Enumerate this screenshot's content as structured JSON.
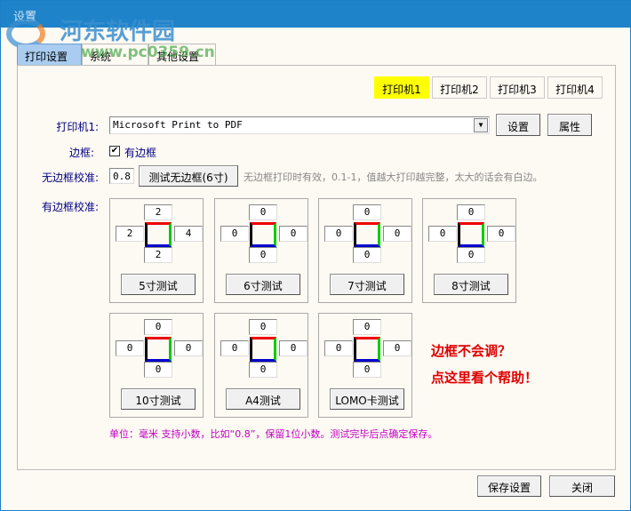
{
  "window": {
    "title": "设置",
    "watermark": "河东软件园",
    "watermark_url": "www.pc0359.cn"
  },
  "tabs": [
    "打印设置",
    "系统",
    "其他设置"
  ],
  "printer_tabs": [
    "打印机1",
    "打印机2",
    "打印机3",
    "打印机4"
  ],
  "printer": {
    "label": "打印机1:",
    "value": "Microsoft Print to PDF",
    "setup": "设置",
    "props": "属性"
  },
  "border": {
    "label": "边框:",
    "checkbox": "有边框",
    "checked": true
  },
  "borderless": {
    "label": "无边框校准:",
    "value": "0.8",
    "test": "测试无边框(6寸)",
    "hint": "无边框打印时有效，0.1-1，值越大打印越完整，太大的话会有白边。"
  },
  "bordered": {
    "label": "有边框校准:"
  },
  "calibrations": [
    {
      "top": "2",
      "left": "2",
      "right": "4",
      "bottom": "2",
      "button": "5寸测试"
    },
    {
      "top": "0",
      "left": "0",
      "right": "0",
      "bottom": "0",
      "button": "6寸测试"
    },
    {
      "top": "0",
      "left": "0",
      "right": "0",
      "bottom": "0",
      "button": "7寸测试"
    },
    {
      "top": "0",
      "left": "0",
      "right": "0",
      "bottom": "0",
      "button": "8寸测试"
    },
    {
      "top": "0",
      "left": "0",
      "right": "0",
      "bottom": "0",
      "button": "10寸测试"
    },
    {
      "top": "0",
      "left": "0",
      "right": "0",
      "bottom": "0",
      "button": "A4测试"
    },
    {
      "top": "0",
      "left": "0",
      "right": "0",
      "bottom": "0",
      "button": "LOMO卡测试"
    }
  ],
  "help": {
    "line1": "边框不会调？",
    "line2": "点这里看个帮助！"
  },
  "note": "单位：毫米   支持小数，比如“0.8”，保留1位小数。测试完毕后点确定保存。",
  "footer": {
    "save": "保存设置",
    "close": "关闭"
  }
}
